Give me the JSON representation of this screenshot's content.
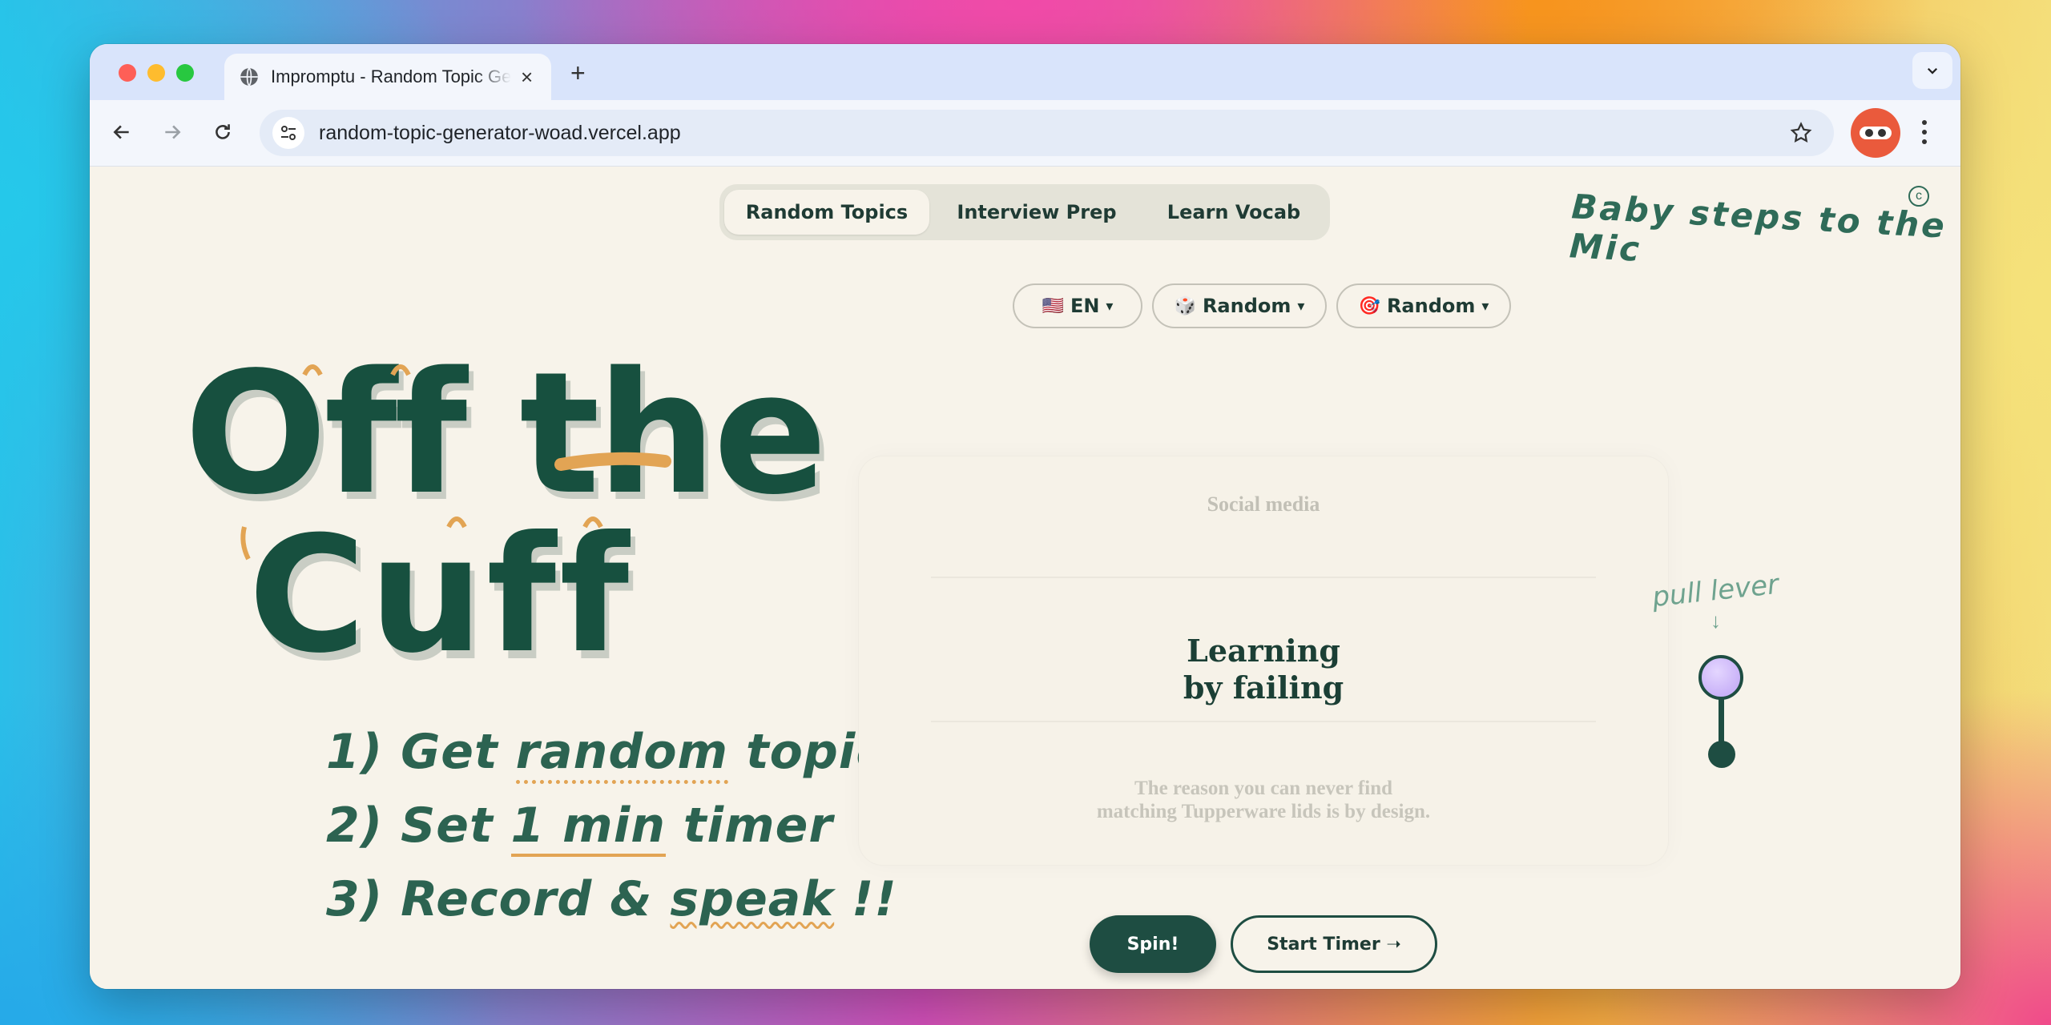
{
  "browser": {
    "tab_title": "Impromptu - Random Topic Generator",
    "new_tab": "+",
    "url": "random-topic-generator-woad.vercel.app"
  },
  "nav": {
    "tabs": [
      {
        "label": "Random Topics",
        "active": true
      },
      {
        "label": "Interview Prep",
        "active": false
      },
      {
        "label": "Learn Vocab",
        "active": false
      }
    ]
  },
  "slogan": "Baby steps to the Mic",
  "copyright": "c",
  "filters": {
    "language": {
      "emoji": "🇺🇸",
      "label": "EN",
      "caret": "▾"
    },
    "category": {
      "emoji": "🎲",
      "label": "Random",
      "caret": "▾"
    },
    "mode": {
      "emoji": "🎯",
      "label": "Random",
      "caret": "▾"
    }
  },
  "logo": {
    "line1": "Off the",
    "line2": "Cuff"
  },
  "steps": [
    {
      "num": "1)",
      "before": "Get ",
      "highlight": "random",
      "after": " topic"
    },
    {
      "num": "2)",
      "before": "Set ",
      "highlight": "1 min",
      "after": " timer"
    },
    {
      "num": "3)",
      "before": "Record & ",
      "highlight": "speak",
      "after": " !!"
    }
  ],
  "topics": {
    "previous": "Social media",
    "current_line1": "Learning",
    "current_line2": "by failing",
    "next_line1": "The reason you can never find",
    "next_line2": "matching Tupperware lids is by design."
  },
  "lever": {
    "note": "pull lever",
    "arrow": "↓"
  },
  "actions": {
    "spin": "Spin!",
    "timer": "Start Timer ➝"
  },
  "colors": {
    "accent_green": "#1e4d42",
    "accent_orange": "#e2a454",
    "background": "#f7f3ea"
  }
}
